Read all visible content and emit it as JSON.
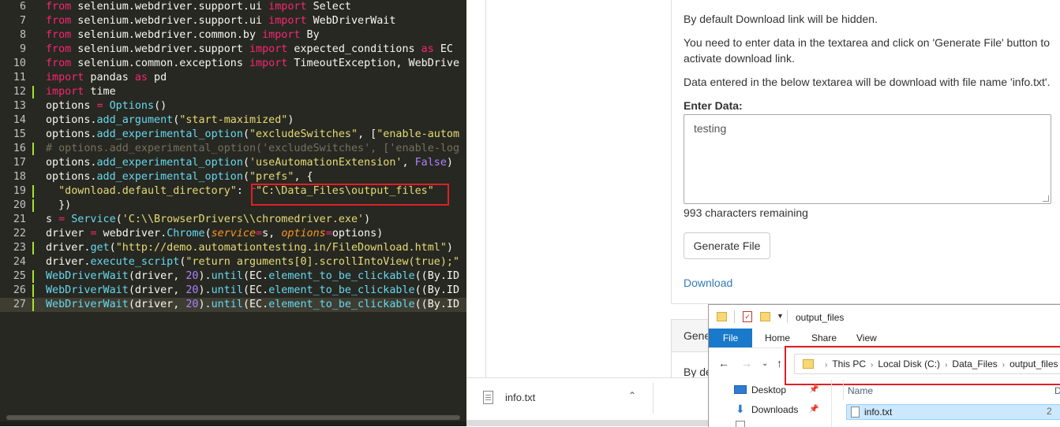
{
  "editor": {
    "lines": [
      {
        "n": "6",
        "tokens": [
          [
            "k",
            "from"
          ],
          [
            "t",
            " selenium.webdriver.support.ui "
          ],
          [
            "k",
            "import"
          ],
          [
            "t",
            " Select"
          ]
        ]
      },
      {
        "n": "7",
        "tokens": [
          [
            "k",
            "from"
          ],
          [
            "t",
            " selenium.webdriver.support.ui "
          ],
          [
            "k",
            "import"
          ],
          [
            "t",
            " WebDriverWait"
          ]
        ]
      },
      {
        "n": "8",
        "tokens": [
          [
            "k",
            "from"
          ],
          [
            "t",
            " selenium.webdriver.common.by "
          ],
          [
            "k",
            "import"
          ],
          [
            "t",
            " By"
          ]
        ]
      },
      {
        "n": "9",
        "tokens": [
          [
            "k",
            "from"
          ],
          [
            "t",
            " selenium.webdriver.support "
          ],
          [
            "k",
            "import"
          ],
          [
            "t",
            " expected_conditions "
          ],
          [
            "k",
            "as"
          ],
          [
            "t",
            " EC"
          ]
        ]
      },
      {
        "n": "10",
        "tokens": [
          [
            "k",
            "from"
          ],
          [
            "t",
            " selenium.common.exceptions "
          ],
          [
            "k",
            "import"
          ],
          [
            "t",
            " TimeoutException, WebDrive"
          ]
        ]
      },
      {
        "n": "11",
        "tokens": [
          [
            "k",
            "import"
          ],
          [
            "t",
            " pandas "
          ],
          [
            "k",
            "as"
          ],
          [
            "t",
            " pd"
          ]
        ]
      },
      {
        "n": "12",
        "mod": true,
        "tokens": [
          [
            "k",
            "import"
          ],
          [
            "t",
            " time"
          ]
        ]
      },
      {
        "n": "13",
        "tokens": [
          [
            "t",
            "options "
          ],
          [
            "k",
            "="
          ],
          [
            "t",
            " "
          ],
          [
            "f",
            "Options"
          ],
          [
            "t",
            "()"
          ]
        ]
      },
      {
        "n": "14",
        "tokens": [
          [
            "t",
            "options."
          ],
          [
            "f",
            "add_argument"
          ],
          [
            "t",
            "("
          ],
          [
            "s",
            "\"start-maximized\""
          ],
          [
            "t",
            ")"
          ]
        ]
      },
      {
        "n": "15",
        "tokens": [
          [
            "t",
            "options."
          ],
          [
            "f",
            "add_experimental_option"
          ],
          [
            "t",
            "("
          ],
          [
            "s",
            "\"excludeSwitches\""
          ],
          [
            "t",
            ", ["
          ],
          [
            "s",
            "\"enable-autom"
          ]
        ]
      },
      {
        "n": "16",
        "mod": true,
        "tokens": [
          [
            "c",
            "# options.add_experimental_option('excludeSwitches', ['enable-log"
          ]
        ]
      },
      {
        "n": "17",
        "tokens": [
          [
            "t",
            "options."
          ],
          [
            "f",
            "add_experimental_option"
          ],
          [
            "t",
            "("
          ],
          [
            "s",
            "'useAutomationExtension'"
          ],
          [
            "t",
            ", "
          ],
          [
            "n",
            "False"
          ],
          [
            "t",
            ")"
          ]
        ]
      },
      {
        "n": "18",
        "tokens": [
          [
            "t",
            "options."
          ],
          [
            "f",
            "add_experimental_option"
          ],
          [
            "t",
            "("
          ],
          [
            "s",
            "\"prefs\""
          ],
          [
            "t",
            ", {"
          ]
        ]
      },
      {
        "n": "19",
        "mod": true,
        "tokens": [
          [
            "t",
            "  "
          ],
          [
            "s",
            "\"download.default_directory\""
          ],
          [
            "t",
            ": "
          ],
          [
            "k",
            "r"
          ],
          [
            "s",
            "\"C:\\Data_Files\\output_files\""
          ]
        ]
      },
      {
        "n": "20",
        "mod": true,
        "tokens": [
          [
            "t",
            "  })"
          ]
        ]
      },
      {
        "n": "21",
        "tokens": [
          [
            "t",
            "s "
          ],
          [
            "k",
            "="
          ],
          [
            "t",
            " "
          ],
          [
            "f",
            "Service"
          ],
          [
            "t",
            "("
          ],
          [
            "s",
            "'C:\\\\BrowserDrivers\\\\chromedriver.exe'"
          ],
          [
            "t",
            ")"
          ]
        ]
      },
      {
        "n": "22",
        "tokens": [
          [
            "t",
            "driver "
          ],
          [
            "k",
            "="
          ],
          [
            "t",
            " webdriver."
          ],
          [
            "f",
            "Chrome"
          ],
          [
            "t",
            "("
          ],
          [
            "p",
            "service"
          ],
          [
            "k",
            "="
          ],
          [
            "t",
            "s, "
          ],
          [
            "p",
            "options"
          ],
          [
            "k",
            "="
          ],
          [
            "t",
            "options)"
          ]
        ]
      },
      {
        "n": "23",
        "mod": true,
        "tokens": [
          [
            "t",
            "driver."
          ],
          [
            "f",
            "get"
          ],
          [
            "t",
            "("
          ],
          [
            "s",
            "\"http://demo.automationtesting.in/FileDownload.html\""
          ],
          [
            "t",
            ")"
          ]
        ]
      },
      {
        "n": "24",
        "tokens": [
          [
            "t",
            "driver."
          ],
          [
            "f",
            "execute_script"
          ],
          [
            "t",
            "("
          ],
          [
            "s",
            "\"return arguments[0].scrollIntoView(true);\""
          ]
        ]
      },
      {
        "n": "25",
        "mod": true,
        "tokens": [
          [
            "f",
            "WebDriverWait"
          ],
          [
            "t",
            "(driver, "
          ],
          [
            "n",
            "20"
          ],
          [
            "t",
            ")."
          ],
          [
            "f",
            "until"
          ],
          [
            "t",
            "(EC."
          ],
          [
            "f",
            "element_to_be_clickable"
          ],
          [
            "t",
            "((By.ID"
          ]
        ]
      },
      {
        "n": "26",
        "mod": true,
        "tokens": [
          [
            "f",
            "WebDriverWait"
          ],
          [
            "t",
            "(driver, "
          ],
          [
            "n",
            "20"
          ],
          [
            "t",
            ")."
          ],
          [
            "f",
            "until"
          ],
          [
            "t",
            "(EC."
          ],
          [
            "f",
            "element_to_be_clickable"
          ],
          [
            "t",
            "((By.ID"
          ]
        ]
      },
      {
        "n": "27",
        "current": true,
        "mod": true,
        "tokens": [
          [
            "f",
            "WebDriverWait"
          ],
          [
            "t",
            "(driver, "
          ],
          [
            "n",
            "20"
          ],
          [
            "t",
            ")."
          ],
          [
            "f",
            "until"
          ],
          [
            "t",
            "(EC."
          ],
          [
            "f",
            "element_to_be_clickable"
          ],
          [
            "t",
            "((By.ID"
          ]
        ]
      }
    ]
  },
  "page": {
    "intro": "By default Download link will be hidden.",
    "instructions": "You need to enter data in the textarea and click on 'Generate File' button to activate download link.",
    "filename_note": "Data entered in the below textarea will be download with file name 'info.txt'.",
    "enter_label": "Enter Data:",
    "textarea_value": "testing",
    "remaining": "993 characters remaining",
    "generate_button": "Generate File",
    "download_link": "Download",
    "panel2_title": "Gene",
    "panel2_text": "By de"
  },
  "download_bar": {
    "file_name": "info.txt"
  },
  "explorer": {
    "title": "output_files",
    "ribbon_tabs": {
      "file": "File",
      "home": "Home",
      "share": "Share",
      "view": "View"
    },
    "breadcrumb": [
      "This PC",
      "Local Disk (C:)",
      "Data_Files",
      "output_files"
    ],
    "nav_items": {
      "desktop": "Desktop",
      "downloads": "Downloads"
    },
    "column_name": "Name",
    "column_rest": "D",
    "file_name": "info.txt",
    "file_rest": "2"
  },
  "colors": {
    "highlight_box": "#e01f26",
    "editor_bg": "#272822",
    "explorer_accent": "#1979ca",
    "link": "#337ab7"
  }
}
